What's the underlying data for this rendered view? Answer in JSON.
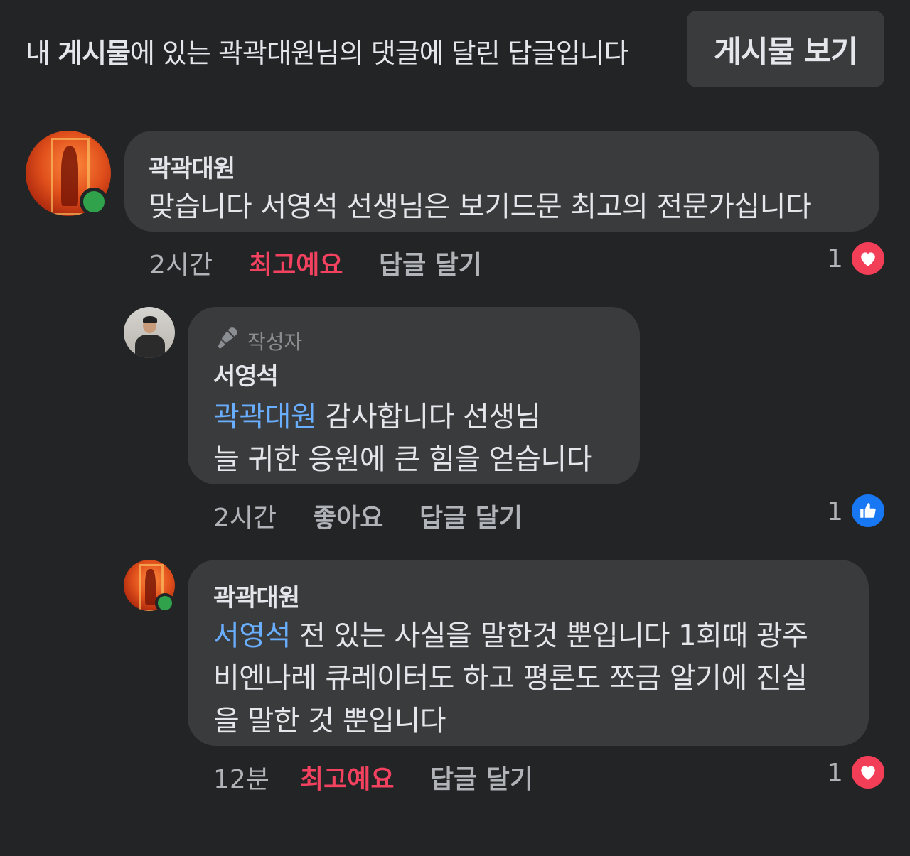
{
  "header": {
    "prefix": "내 ",
    "bold": "게시물",
    "suffix": "에 있는 곽곽대원님의 댓글에 달린 답글입니다",
    "view_post_label": "게시물 보기"
  },
  "comments": [
    {
      "author": "곽곽대원",
      "text": "맞습니다 서영석 선생님은 보기드문 최고의 전문가십니다",
      "time": "2시간",
      "reaction_label": "최고예요",
      "reply_label": "답글 달기",
      "reaction_count": "1",
      "reaction_icon": "heart-icon",
      "online": true
    },
    {
      "author_badge": "작성자",
      "author": "서영석",
      "mention": "곽곽대원",
      "text_line1": " 감사합니다 선생님",
      "text_line2": "늘 귀한 응원에 큰 힘을 얻습니다",
      "time": "2시간",
      "reaction_label": "좋아요",
      "reply_label": "답글 달기",
      "reaction_count": "1",
      "reaction_icon": "thumbs-up-icon"
    },
    {
      "author": "곽곽대원",
      "mention": "서영석",
      "text_line1": " 전 있는 사실을 말한것 뿐입니다 1회때 광주",
      "text_line2": "비엔나레 큐레이터도 하고 평론도 쪼금 알기에 진실",
      "text_line3": "을 말한 것 뿐입니다",
      "time": "12분",
      "reaction_label": "최고예요",
      "reply_label": "답글 달기",
      "reaction_count": "1",
      "reaction_icon": "heart-icon",
      "online": true
    }
  ],
  "colors": {
    "background": "#232426",
    "bubble": "#3a3b3c",
    "mention": "#6aaeff",
    "love": "#f3425f",
    "like": "#1877f2",
    "online": "#31a24c"
  }
}
